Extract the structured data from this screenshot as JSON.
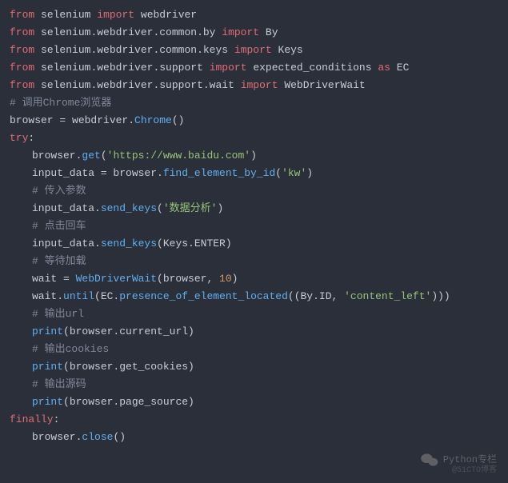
{
  "code": {
    "l1": {
      "from": "from",
      "mod": "selenium",
      "imp": "import",
      "name": "webdriver"
    },
    "l2": {
      "from": "from",
      "mod": "selenium.webdriver.common.by",
      "imp": "import",
      "name": "By"
    },
    "l3": {
      "from": "from",
      "mod": "selenium.webdriver.common.keys",
      "imp": "import",
      "name": "Keys"
    },
    "l4": {
      "from": "from",
      "mod": "selenium.webdriver.support",
      "imp": "import",
      "name": "expected_conditions",
      "as": "as",
      "alias": "EC"
    },
    "l5": {
      "from": "from",
      "mod": "selenium.webdriver.support.wait",
      "imp": "import",
      "name": "WebDriverWait"
    },
    "l6": "# 调用Chrome浏览器",
    "l7": {
      "lhs": "browser = webdriver.",
      "fn": "Chrome",
      "rhs": "()"
    },
    "l8": "",
    "l9": {
      "kw": "try",
      "colon": ":"
    },
    "l10": {
      "a": "browser.",
      "fn": "get",
      "b": "(",
      "s": "'https://www.baidu.com'",
      "c": ")"
    },
    "l11": {
      "a": "input_data = browser.",
      "fn": "find_element_by_id",
      "b": "(",
      "s": "'kw'",
      "c": ")"
    },
    "l12": "# 传入参数",
    "l13": {
      "a": "input_data.",
      "fn": "send_keys",
      "b": "(",
      "s": "'数据分析'",
      "c": ")"
    },
    "l14": "# 点击回车",
    "l15": {
      "a": "input_data.",
      "fn": "send_keys",
      "b": "(Keys.ENTER)"
    },
    "l16": "# 等待加载",
    "l17": {
      "a": "wait = ",
      "fn": "WebDriverWait",
      "b": "(browser, ",
      "n": "10",
      "c": ")"
    },
    "l18": {
      "a": "wait.",
      "fn": "until",
      "b": "(EC.",
      "fn2": "presence_of_element_located",
      "c": "((By.ID, ",
      "s": "'content_left'",
      "d": ")))"
    },
    "l19": "# 输出url",
    "l20": {
      "fn": "print",
      "a": "(browser.current_url)"
    },
    "l21": "# 输出cookies",
    "l22": {
      "fn": "print",
      "a": "(browser.get_cookies)"
    },
    "l23": "# 输出源码",
    "l24": {
      "fn": "print",
      "a": "(browser.page_source)"
    },
    "l25": {
      "kw": "finally",
      "colon": ":"
    },
    "l26": {
      "a": "browser.",
      "fn": "close",
      "b": "()"
    }
  },
  "watermark": {
    "text": "Python专栏",
    "sub": "@51CTO博客"
  }
}
